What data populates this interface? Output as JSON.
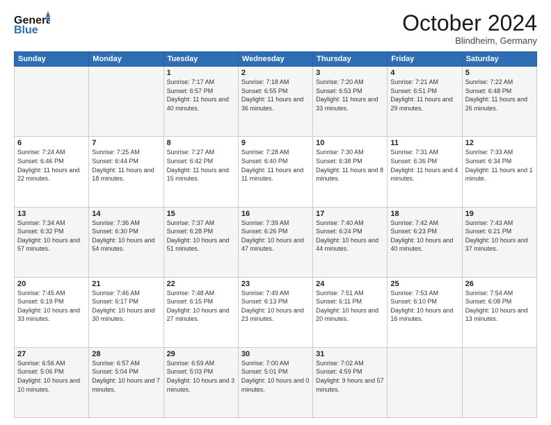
{
  "header": {
    "logo_line1": "General",
    "logo_line2": "Blue",
    "month": "October 2024",
    "location": "Blindheim, Germany"
  },
  "weekdays": [
    "Sunday",
    "Monday",
    "Tuesday",
    "Wednesday",
    "Thursday",
    "Friday",
    "Saturday"
  ],
  "weeks": [
    [
      {
        "day": "",
        "sunrise": "",
        "sunset": "",
        "daylight": ""
      },
      {
        "day": "",
        "sunrise": "",
        "sunset": "",
        "daylight": ""
      },
      {
        "day": "1",
        "sunrise": "Sunrise: 7:17 AM",
        "sunset": "Sunset: 6:57 PM",
        "daylight": "Daylight: 11 hours and 40 minutes."
      },
      {
        "day": "2",
        "sunrise": "Sunrise: 7:18 AM",
        "sunset": "Sunset: 6:55 PM",
        "daylight": "Daylight: 11 hours and 36 minutes."
      },
      {
        "day": "3",
        "sunrise": "Sunrise: 7:20 AM",
        "sunset": "Sunset: 6:53 PM",
        "daylight": "Daylight: 11 hours and 33 minutes."
      },
      {
        "day": "4",
        "sunrise": "Sunrise: 7:21 AM",
        "sunset": "Sunset: 6:51 PM",
        "daylight": "Daylight: 11 hours and 29 minutes."
      },
      {
        "day": "5",
        "sunrise": "Sunrise: 7:22 AM",
        "sunset": "Sunset: 6:48 PM",
        "daylight": "Daylight: 11 hours and 26 minutes."
      }
    ],
    [
      {
        "day": "6",
        "sunrise": "Sunrise: 7:24 AM",
        "sunset": "Sunset: 6:46 PM",
        "daylight": "Daylight: 11 hours and 22 minutes."
      },
      {
        "day": "7",
        "sunrise": "Sunrise: 7:25 AM",
        "sunset": "Sunset: 6:44 PM",
        "daylight": "Daylight: 11 hours and 18 minutes."
      },
      {
        "day": "8",
        "sunrise": "Sunrise: 7:27 AM",
        "sunset": "Sunset: 6:42 PM",
        "daylight": "Daylight: 11 hours and 15 minutes."
      },
      {
        "day": "9",
        "sunrise": "Sunrise: 7:28 AM",
        "sunset": "Sunset: 6:40 PM",
        "daylight": "Daylight: 11 hours and 11 minutes."
      },
      {
        "day": "10",
        "sunrise": "Sunrise: 7:30 AM",
        "sunset": "Sunset: 6:38 PM",
        "daylight": "Daylight: 11 hours and 8 minutes."
      },
      {
        "day": "11",
        "sunrise": "Sunrise: 7:31 AM",
        "sunset": "Sunset: 6:36 PM",
        "daylight": "Daylight: 11 hours and 4 minutes."
      },
      {
        "day": "12",
        "sunrise": "Sunrise: 7:33 AM",
        "sunset": "Sunset: 6:34 PM",
        "daylight": "Daylight: 11 hours and 1 minute."
      }
    ],
    [
      {
        "day": "13",
        "sunrise": "Sunrise: 7:34 AM",
        "sunset": "Sunset: 6:32 PM",
        "daylight": "Daylight: 10 hours and 57 minutes."
      },
      {
        "day": "14",
        "sunrise": "Sunrise: 7:36 AM",
        "sunset": "Sunset: 6:30 PM",
        "daylight": "Daylight: 10 hours and 54 minutes."
      },
      {
        "day": "15",
        "sunrise": "Sunrise: 7:37 AM",
        "sunset": "Sunset: 6:28 PM",
        "daylight": "Daylight: 10 hours and 51 minutes."
      },
      {
        "day": "16",
        "sunrise": "Sunrise: 7:39 AM",
        "sunset": "Sunset: 6:26 PM",
        "daylight": "Daylight: 10 hours and 47 minutes."
      },
      {
        "day": "17",
        "sunrise": "Sunrise: 7:40 AM",
        "sunset": "Sunset: 6:24 PM",
        "daylight": "Daylight: 10 hours and 44 minutes."
      },
      {
        "day": "18",
        "sunrise": "Sunrise: 7:42 AM",
        "sunset": "Sunset: 6:23 PM",
        "daylight": "Daylight: 10 hours and 40 minutes."
      },
      {
        "day": "19",
        "sunrise": "Sunrise: 7:43 AM",
        "sunset": "Sunset: 6:21 PM",
        "daylight": "Daylight: 10 hours and 37 minutes."
      }
    ],
    [
      {
        "day": "20",
        "sunrise": "Sunrise: 7:45 AM",
        "sunset": "Sunset: 6:19 PM",
        "daylight": "Daylight: 10 hours and 33 minutes."
      },
      {
        "day": "21",
        "sunrise": "Sunrise: 7:46 AM",
        "sunset": "Sunset: 6:17 PM",
        "daylight": "Daylight: 10 hours and 30 minutes."
      },
      {
        "day": "22",
        "sunrise": "Sunrise: 7:48 AM",
        "sunset": "Sunset: 6:15 PM",
        "daylight": "Daylight: 10 hours and 27 minutes."
      },
      {
        "day": "23",
        "sunrise": "Sunrise: 7:49 AM",
        "sunset": "Sunset: 6:13 PM",
        "daylight": "Daylight: 10 hours and 23 minutes."
      },
      {
        "day": "24",
        "sunrise": "Sunrise: 7:51 AM",
        "sunset": "Sunset: 6:11 PM",
        "daylight": "Daylight: 10 hours and 20 minutes."
      },
      {
        "day": "25",
        "sunrise": "Sunrise: 7:53 AM",
        "sunset": "Sunset: 6:10 PM",
        "daylight": "Daylight: 10 hours and 16 minutes."
      },
      {
        "day": "26",
        "sunrise": "Sunrise: 7:54 AM",
        "sunset": "Sunset: 6:08 PM",
        "daylight": "Daylight: 10 hours and 13 minutes."
      }
    ],
    [
      {
        "day": "27",
        "sunrise": "Sunrise: 6:56 AM",
        "sunset": "Sunset: 5:06 PM",
        "daylight": "Daylight: 10 hours and 10 minutes."
      },
      {
        "day": "28",
        "sunrise": "Sunrise: 6:57 AM",
        "sunset": "Sunset: 5:04 PM",
        "daylight": "Daylight: 10 hours and 7 minutes."
      },
      {
        "day": "29",
        "sunrise": "Sunrise: 6:59 AM",
        "sunset": "Sunset: 5:03 PM",
        "daylight": "Daylight: 10 hours and 3 minutes."
      },
      {
        "day": "30",
        "sunrise": "Sunrise: 7:00 AM",
        "sunset": "Sunset: 5:01 PM",
        "daylight": "Daylight: 10 hours and 0 minutes."
      },
      {
        "day": "31",
        "sunrise": "Sunrise: 7:02 AM",
        "sunset": "Sunset: 4:59 PM",
        "daylight": "Daylight: 9 hours and 57 minutes."
      },
      {
        "day": "",
        "sunrise": "",
        "sunset": "",
        "daylight": ""
      },
      {
        "day": "",
        "sunrise": "",
        "sunset": "",
        "daylight": ""
      }
    ]
  ]
}
